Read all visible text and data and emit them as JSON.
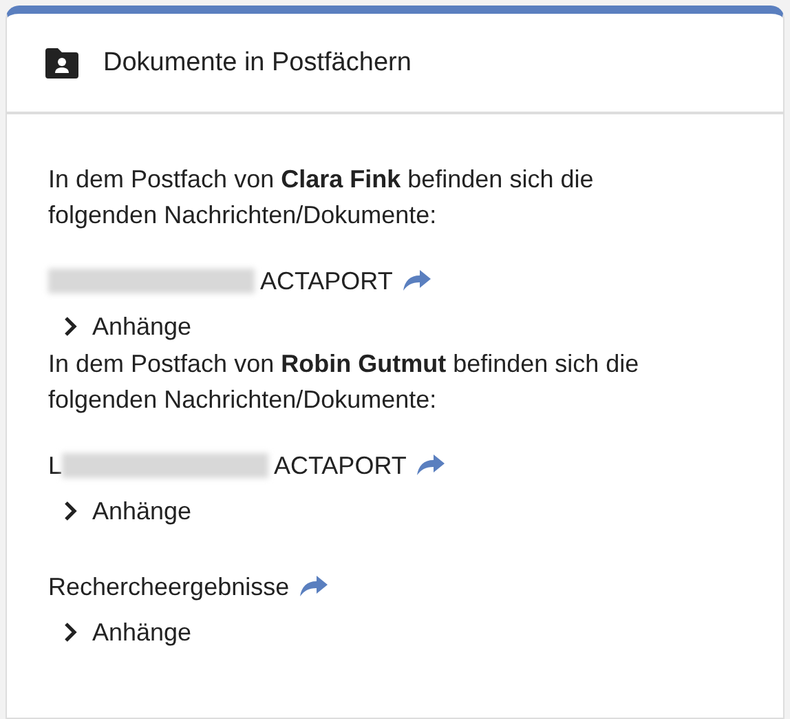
{
  "card": {
    "title": "Dokumente in Postfächern"
  },
  "mailboxes": [
    {
      "intro": "In dem Postfach von **Clara Fink** befinden sich die folgenden Nachrichten/Dokumente:",
      "documents": [
        {
          "redacted": true,
          "title": "ACTAPORT",
          "attachments": {
            "label": "Anhänge",
            "expanded": false
          }
        }
      ]
    },
    {
      "intro": "In dem Postfach von **Robin Gutmut** befinden sich die folgenden Nachrichten/Dokumente:",
      "documents": [
        {
          "prefix": "L",
          "redacted": true,
          "title": "ACTAPORT",
          "attachments": {
            "label": "Anhänge",
            "expanded": false
          }
        },
        {
          "redacted": false,
          "title": "Rechercheergebnisse",
          "attachments": {
            "label": "Anhänge",
            "expanded": false
          }
        }
      ]
    }
  ]
}
